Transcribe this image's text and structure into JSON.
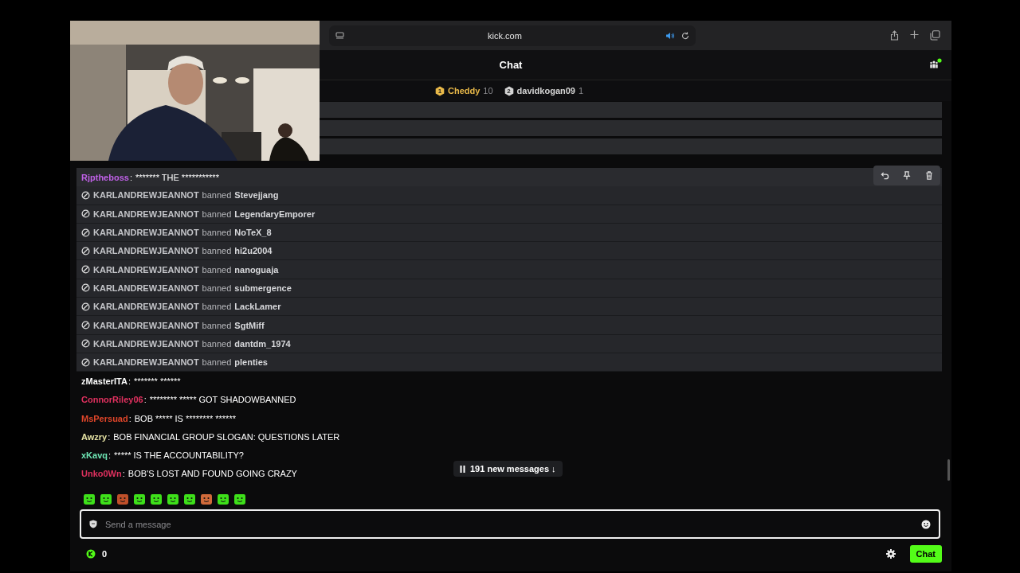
{
  "browser": {
    "address": "kick.com"
  },
  "chat": {
    "title": "Chat"
  },
  "leaderboard": [
    {
      "rank": "1",
      "name": "Cheddy",
      "count": "10",
      "color": "#e9b949"
    },
    {
      "rank": "2",
      "name": "davidkogan09",
      "count": "1",
      "color": "#d4d4d4"
    }
  ],
  "messages": [
    {
      "kind": "chat",
      "user": "Rjptheboss",
      "color": "#c061e8",
      "separator": ":",
      "text": "******* THE ***********",
      "highlighted": true
    },
    {
      "kind": "ban",
      "moderator": "KARLANDREWJEANNOT",
      "action": "banned",
      "target": "Stevejjang",
      "highlighted": false
    },
    {
      "kind": "ban",
      "moderator": "KARLANDREWJEANNOT",
      "action": "banned",
      "target": "LegendaryEmporer",
      "highlighted": false
    },
    {
      "kind": "ban",
      "moderator": "KARLANDREWJEANNOT",
      "action": "banned",
      "target": "NoTeX_8",
      "highlighted": false
    },
    {
      "kind": "ban",
      "moderator": "KARLANDREWJEANNOT",
      "action": "banned",
      "target": "hi2u2004",
      "highlighted": false
    },
    {
      "kind": "ban",
      "moderator": "KARLANDREWJEANNOT",
      "action": "banned",
      "target": "nanoguaja",
      "highlighted": false
    },
    {
      "kind": "ban",
      "moderator": "KARLANDREWJEANNOT",
      "action": "banned",
      "target": "submergence",
      "highlighted": false
    },
    {
      "kind": "ban",
      "moderator": "KARLANDREWJEANNOT",
      "action": "banned",
      "target": "LackLamer",
      "highlighted": false
    },
    {
      "kind": "ban",
      "moderator": "KARLANDREWJEANNOT",
      "action": "banned",
      "target": "SgtMiff",
      "highlighted": false
    },
    {
      "kind": "ban",
      "moderator": "KARLANDREWJEANNOT",
      "action": "banned",
      "target": "dantdm_1974",
      "highlighted": false
    },
    {
      "kind": "ban",
      "moderator": "KARLANDREWJEANNOT",
      "action": "banned",
      "target": "plenties",
      "highlighted": false
    },
    {
      "kind": "chat",
      "user": "zMasterITA",
      "color": "#ffffff",
      "separator": ":",
      "text": "******* ******",
      "highlighted": false
    },
    {
      "kind": "chat",
      "user": "ConnorRiley06",
      "color": "#e0315f",
      "separator": ":",
      "text": "******** ***** GOT SHADOWBANNED",
      "highlighted": false
    },
    {
      "kind": "chat",
      "user": "MsPersuad",
      "color": "#e0462a",
      "separator": ":",
      "text": "BOB ***** IS ******** ******",
      "highlighted": false
    },
    {
      "kind": "chat",
      "user": "Awzry",
      "color": "#e6e3a4",
      "separator": ":",
      "text": "BOB FINANCIAL GROUP SLOGAN: QUESTIONS LATER",
      "highlighted": false
    },
    {
      "kind": "chat",
      "user": "xKavq",
      "color": "#6fe8b6",
      "separator": ":",
      "text": "***** IS THE ACCOUNTABILITY?",
      "highlighted": false
    },
    {
      "kind": "chat",
      "user": "Unko0Wn",
      "color": "#e0315f",
      "separator": ":",
      "text": "BOB'S LOST AND FOUND GOING CRAZY",
      "highlighted": false
    }
  ],
  "new_messages": {
    "label": "191 new messages ↓"
  },
  "composer": {
    "placeholder": "Send a message"
  },
  "footer": {
    "points": "0",
    "send": "Chat"
  }
}
